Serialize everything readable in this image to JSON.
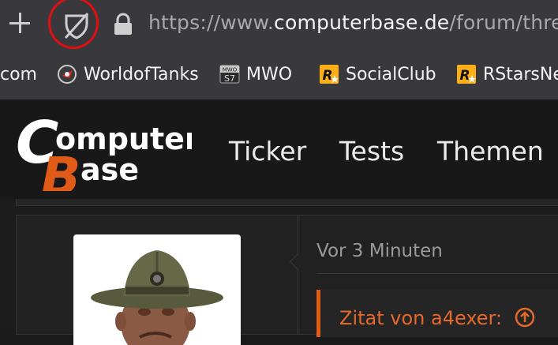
{
  "browser": {
    "url_prefix": "https://www.",
    "url_host": "computerbase.de",
    "url_path": "/forum/threa",
    "bookmarks": [
      {
        "label": "com",
        "icon": "none"
      },
      {
        "label": "WorldofTanks",
        "icon": "worldoftanks-icon"
      },
      {
        "label": "MWO",
        "icon": "mwo-icon",
        "icon_text_top": "MWO",
        "icon_text_bottom": "S7"
      },
      {
        "label": "SocialClub",
        "icon": "rockstar-icon",
        "icon_text": "R"
      },
      {
        "label": "RStarsNe",
        "icon": "rockstar-icon",
        "icon_text": "R"
      }
    ]
  },
  "site": {
    "logo_line1": "omputer",
    "logo_line2": "ase",
    "logo_letter1": "C",
    "logo_letter2": "B",
    "nav": [
      "Ticker",
      "Tests",
      "Themen"
    ]
  },
  "post": {
    "time": "Vor 3 Minuten",
    "quote_label": "Zitat von a4exer:"
  },
  "colors": {
    "accent": "#e05a18",
    "annotation_circle": "#e01010",
    "toolbar_bg": "#38383d",
    "page_bg": "#1a1a1a"
  }
}
